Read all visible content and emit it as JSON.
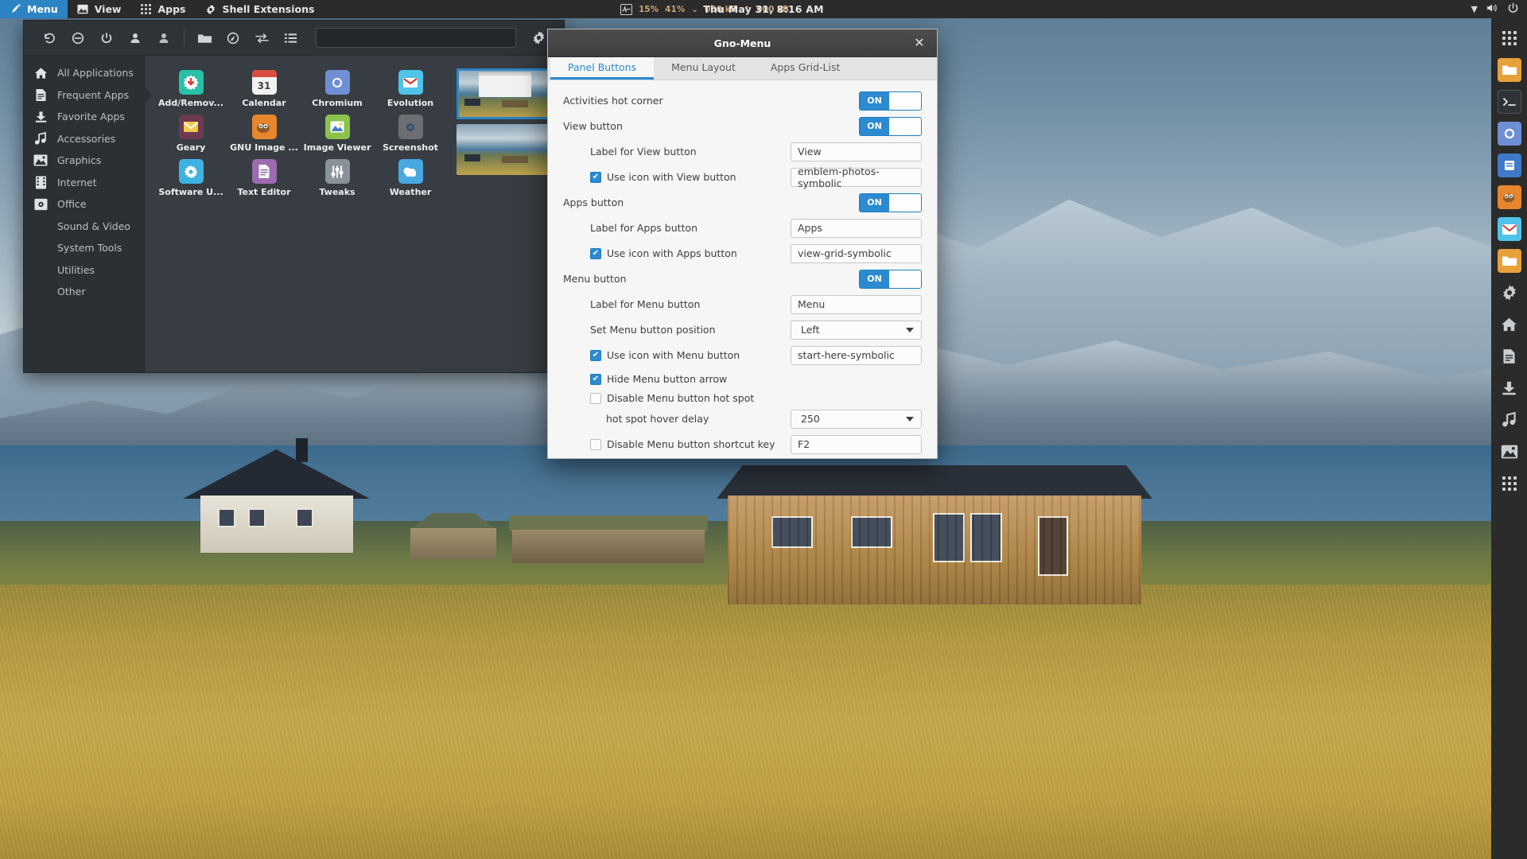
{
  "topbar": {
    "buttons": [
      {
        "label": "Menu",
        "icon": "start-here-icon",
        "active": true
      },
      {
        "label": "View",
        "icon": "emblem-photos-icon",
        "active": false
      },
      {
        "label": "Apps",
        "icon": "view-grid-icon",
        "active": false
      },
      {
        "label": "Shell Extensions",
        "icon": "gear-icon",
        "active": false
      }
    ],
    "clock": "Thu May 31,  8:16 AM",
    "sysmon": {
      "cpu": "15%",
      "memory": "41%",
      "net_down": "000 kB",
      "net_up": "000 kB"
    },
    "tray": [
      "chevron-down-icon",
      "volume-icon",
      "power-icon"
    ]
  },
  "gnomenu": {
    "toolbar_icons": [
      "undo-icon",
      "minus-circle-icon",
      "power-icon",
      "user-icon",
      "user-switch-icon",
      "folder-icon",
      "pin-icon",
      "arrows-swap-icon",
      "list-icon"
    ],
    "search_placeholder": "",
    "settings_icon": "gear-icon",
    "categories": [
      {
        "label": "All Applications",
        "icon": "home-icon",
        "selected": false
      },
      {
        "label": "Frequent Apps",
        "icon": "document-icon",
        "selected": true
      },
      {
        "label": "Favorite Apps",
        "icon": "download-icon",
        "selected": false
      },
      {
        "label": "Accessories",
        "icon": "music-icon",
        "selected": false
      },
      {
        "label": "Graphics",
        "icon": "image-icon",
        "selected": false
      },
      {
        "label": "Internet",
        "icon": "film-icon",
        "selected": false
      },
      {
        "label": "Office",
        "icon": "media-icon",
        "selected": false
      },
      {
        "label": "Sound & Video",
        "icon": "",
        "selected": false
      },
      {
        "label": "System Tools",
        "icon": "",
        "selected": false
      },
      {
        "label": "Utilities",
        "icon": "",
        "selected": false
      },
      {
        "label": "Other",
        "icon": "",
        "selected": false
      }
    ],
    "apps": [
      {
        "label": "Add/Remov...",
        "icon": "software-install-icon",
        "color": "#28c0a8",
        "glyph": "⬇"
      },
      {
        "label": "Calendar",
        "icon": "calendar-icon",
        "color": "#f4f4f4",
        "glyph": "31"
      },
      {
        "label": "Chromium",
        "icon": "chromium-icon",
        "color": "#6f8fd4",
        "glyph": "◍"
      },
      {
        "label": "Evolution",
        "icon": "evolution-icon",
        "color": "#4fc3e8",
        "glyph": "✉"
      },
      {
        "label": "Geary",
        "icon": "geary-icon",
        "color": "#6d3a52",
        "glyph": "✉"
      },
      {
        "label": "GNU Image ...",
        "icon": "gimp-icon",
        "color": "#e8862d",
        "glyph": "🐺"
      },
      {
        "label": "Image Viewer",
        "icon": "image-viewer-icon",
        "color": "#8bc34a",
        "glyph": "🖼"
      },
      {
        "label": "Screenshot",
        "icon": "screenshot-icon",
        "color": "#6b6f73",
        "glyph": "◎"
      },
      {
        "label": "Software U...",
        "icon": "software-update-icon",
        "color": "#3eb2e0",
        "glyph": "⚙"
      },
      {
        "label": "Text Editor",
        "icon": "text-editor-icon",
        "color": "#9c6bb0",
        "glyph": "📄"
      },
      {
        "label": "Tweaks",
        "icon": "tweaks-icon",
        "color": "#7f8a94",
        "glyph": "⚙"
      },
      {
        "label": "Weather",
        "icon": "weather-icon",
        "color": "#48a8e0",
        "glyph": "☁"
      }
    ],
    "previews": [
      {
        "name": "workspace-preview-1",
        "selected": true
      },
      {
        "name": "workspace-preview-2",
        "selected": false
      }
    ]
  },
  "prefs": {
    "title": "Gno-Menu",
    "close_label": "✕",
    "tabs": [
      {
        "label": "Panel Buttons",
        "active": true
      },
      {
        "label": "Menu Layout",
        "active": false
      },
      {
        "label": "Apps Grid-List",
        "active": false
      }
    ],
    "toggle_on_label": "ON",
    "rows": [
      {
        "type": "toggle",
        "indent": 0,
        "label": "Activities hot corner",
        "value": "ON"
      },
      {
        "type": "toggle",
        "indent": 0,
        "label": "View button",
        "value": "ON"
      },
      {
        "type": "field",
        "indent": 1,
        "label": "Label for View button",
        "value": "View"
      },
      {
        "type": "checkbox-field",
        "indent": 1,
        "label": "Use icon with View button",
        "checked": true,
        "value": "emblem-photos-symbolic"
      },
      {
        "type": "toggle",
        "indent": 0,
        "label": "Apps button",
        "value": "ON"
      },
      {
        "type": "field",
        "indent": 1,
        "label": "Label for Apps button",
        "value": "Apps"
      },
      {
        "type": "checkbox-field",
        "indent": 1,
        "label": "Use icon with Apps button",
        "checked": true,
        "value": "view-grid-symbolic"
      },
      {
        "type": "toggle",
        "indent": 0,
        "label": "Menu button",
        "value": "ON"
      },
      {
        "type": "field",
        "indent": 1,
        "label": "Label for Menu button",
        "value": "Menu"
      },
      {
        "type": "combo",
        "indent": 1,
        "label": "Set Menu button position",
        "value": "Left"
      },
      {
        "type": "checkbox-field",
        "indent": 1,
        "label": "Use icon with Menu button",
        "checked": true,
        "value": "start-here-symbolic"
      },
      {
        "type": "checkbox",
        "indent": 1,
        "label": "Hide Menu button arrow",
        "checked": true
      },
      {
        "type": "checkbox",
        "indent": 1,
        "label": "Disable Menu button hot spot",
        "checked": false
      },
      {
        "type": "combo",
        "indent": 2,
        "label": "hot spot hover delay",
        "value": "250"
      },
      {
        "type": "checkbox-field",
        "indent": 1,
        "label": "Disable Menu button shortcut key",
        "checked": false,
        "value": "F2"
      }
    ]
  },
  "dock": {
    "items": [
      {
        "name": "show-applications-icon",
        "color": "transparent",
        "glyph": ""
      },
      {
        "name": "files-icon",
        "color": "#e8a13a",
        "glyph": ""
      },
      {
        "name": "terminal-icon",
        "color": "#2e3337",
        "glyph": ">_"
      },
      {
        "name": "chromium-icon",
        "color": "#6f8fd4",
        "glyph": "◍"
      },
      {
        "name": "text-editor-icon",
        "color": "#3f79c8",
        "glyph": ""
      },
      {
        "name": "gimp-icon",
        "color": "#e8862d",
        "glyph": ""
      },
      {
        "name": "evolution-icon",
        "color": "#4fc3e8",
        "glyph": "✉"
      },
      {
        "name": "folder-icon",
        "color": "#e8a13a",
        "glyph": ""
      },
      {
        "name": "settings-icon",
        "color": "#7f8a94",
        "glyph": "⚙"
      },
      {
        "name": "home-icon",
        "color": "#7f8a94",
        "glyph": "⌂"
      },
      {
        "name": "document-icon",
        "color": "#8a9399",
        "glyph": "🗎"
      },
      {
        "name": "download-icon",
        "color": "#8a9399",
        "glyph": "⬇"
      },
      {
        "name": "music-icon",
        "color": "#8a9399",
        "glyph": "♪"
      },
      {
        "name": "image-icon",
        "color": "#8a9399",
        "glyph": "🖼"
      },
      {
        "name": "grid-icon",
        "color": "transparent",
        "glyph": ""
      }
    ]
  }
}
